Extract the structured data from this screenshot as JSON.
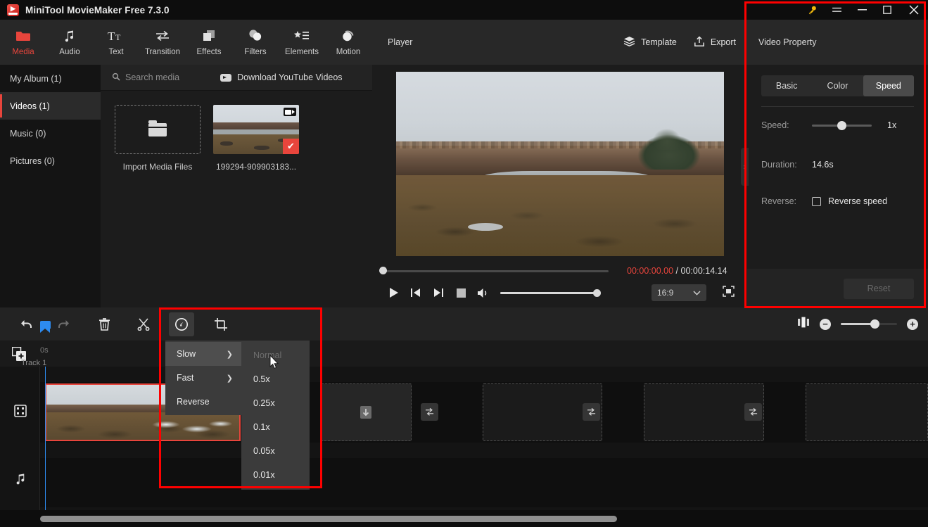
{
  "app": {
    "title": "MiniTool MovieMaker Free 7.3.0",
    "logo_icon": "app-logo-icon",
    "window_buttons": [
      {
        "name": "activate-key",
        "glyph": "⚿"
      },
      {
        "name": "menu",
        "glyph": "≡"
      },
      {
        "name": "minimize",
        "glyph": "—"
      },
      {
        "name": "maximize",
        "glyph": "□"
      },
      {
        "name": "close",
        "glyph": "✕"
      }
    ]
  },
  "topnav": {
    "items": [
      {
        "label": "Media",
        "icon": "folder-icon",
        "active": true
      },
      {
        "label": "Audio",
        "icon": "music-note-icon",
        "active": false
      },
      {
        "label": "Text",
        "icon": "text-icon",
        "active": false
      },
      {
        "label": "Transition",
        "icon": "transition-arrows-icon",
        "active": false
      },
      {
        "label": "Effects",
        "icon": "layers-square-icon",
        "active": false
      },
      {
        "label": "Filters",
        "icon": "filters-circles-icon",
        "active": false
      },
      {
        "label": "Elements",
        "icon": "elements-star-list-icon",
        "active": false
      },
      {
        "label": "Motion",
        "icon": "motion-circle-icon",
        "active": false
      }
    ]
  },
  "sidebar": {
    "items": [
      {
        "label": "My Album (1)",
        "active": false
      },
      {
        "label": "Videos (1)",
        "active": true
      },
      {
        "label": "Music (0)",
        "active": false
      },
      {
        "label": "Pictures (0)",
        "active": false
      }
    ]
  },
  "media": {
    "search_placeholder": "Search media",
    "search_icon": "search-icon",
    "download_label": "Download YouTube Videos",
    "download_icon": "youtube-icon",
    "import_label": "Import Media Files",
    "import_icon": "folder-icon",
    "clip_name": "199294-909903183...",
    "clip_badge_icon": "video-camera-icon",
    "clip_selected_icon": "check-icon"
  },
  "player": {
    "title": "Player",
    "template_label": "Template",
    "template_icon": "layers-icon",
    "export_label": "Export",
    "export_icon": "upload-icon",
    "time_current": "00:00:00.00",
    "time_separator": "/",
    "time_total": "00:00:14.14",
    "controls": [
      {
        "name": "play-button",
        "icon": "play-icon"
      },
      {
        "name": "prev-frame-button",
        "icon": "previous-frame-icon"
      },
      {
        "name": "next-frame-button",
        "icon": "next-frame-icon"
      },
      {
        "name": "stop-button",
        "icon": "stop-icon"
      },
      {
        "name": "volume-button",
        "icon": "volume-icon"
      }
    ],
    "aspect_ratio": "16:9",
    "aspect_ratio_caret": "⌄",
    "fullscreen_icon": "fullscreen-icon",
    "volume_percent": 100
  },
  "property_panel": {
    "title": "Video Property",
    "collapse_icon": "chevron-right-icon",
    "tabs": [
      {
        "label": "Basic",
        "active": false
      },
      {
        "label": "Color",
        "active": false
      },
      {
        "label": "Speed",
        "active": true
      }
    ],
    "speed_label": "Speed:",
    "speed_value": "1x",
    "duration_label": "Duration:",
    "duration_value": "14.6s",
    "reverse_label": "Reverse:",
    "reverse_checkbox_label": "Reverse speed",
    "reverse_checked": false,
    "reset_label": "Reset",
    "reset_enabled": false
  },
  "timeline": {
    "toolbar_left": [
      {
        "name": "undo-button",
        "icon": "undo-icon",
        "dim": false
      },
      {
        "name": "redo-button",
        "icon": "redo-icon",
        "dim": true
      },
      {
        "name": "delete-button",
        "icon": "trash-icon",
        "dim": false
      },
      {
        "name": "split-button",
        "icon": "scissors-icon",
        "dim": false
      },
      {
        "name": "speed-button",
        "icon": "speedometer-icon",
        "dim": false,
        "selected": true
      },
      {
        "name": "crop-button",
        "icon": "crop-icon",
        "dim": false
      }
    ],
    "toolbar_right": [
      {
        "name": "split-view-button",
        "icon": "split-view-icon"
      },
      {
        "name": "zoom-out-button",
        "icon": "minus-circle-icon"
      },
      {
        "name": "zoom-in-button",
        "icon": "plus-circle-icon"
      }
    ],
    "add_track_icon": "add-track-icon",
    "ruler_zero": "0s",
    "track_label": "Track 1",
    "video_track_icon": "film-strip-icon",
    "audio_track_icon": "music-note-icon",
    "transition_icon": "transition-arrows-icon",
    "placeholder_icon": "download-box-icon",
    "zoom_percent": 54
  },
  "speed_menu": {
    "items": [
      {
        "label": "Slow",
        "has_submenu": true,
        "highlighted": true
      },
      {
        "label": "Fast",
        "has_submenu": true,
        "highlighted": false
      },
      {
        "label": "Reverse",
        "has_submenu": false,
        "highlighted": false
      }
    ],
    "submenu_arrow": "›",
    "submenu": [
      {
        "label": "Normal",
        "disabled": true
      },
      {
        "label": "0.5x",
        "disabled": false
      },
      {
        "label": "0.25x",
        "disabled": false
      },
      {
        "label": "0.1x",
        "disabled": false
      },
      {
        "label": "0.05x",
        "disabled": false
      },
      {
        "label": "0.01x",
        "disabled": false
      }
    ]
  },
  "annotations": {
    "accent_color": "#fe0000",
    "boxes": [
      "video-property-panel",
      "speed-menu"
    ]
  },
  "colors": {
    "brand_red": "#e8453c",
    "annotation_red": "#fe0000",
    "playhead_blue": "#2d8bf0",
    "panel_bg": "#1c1c1c",
    "toolbar_bg": "#282828"
  }
}
